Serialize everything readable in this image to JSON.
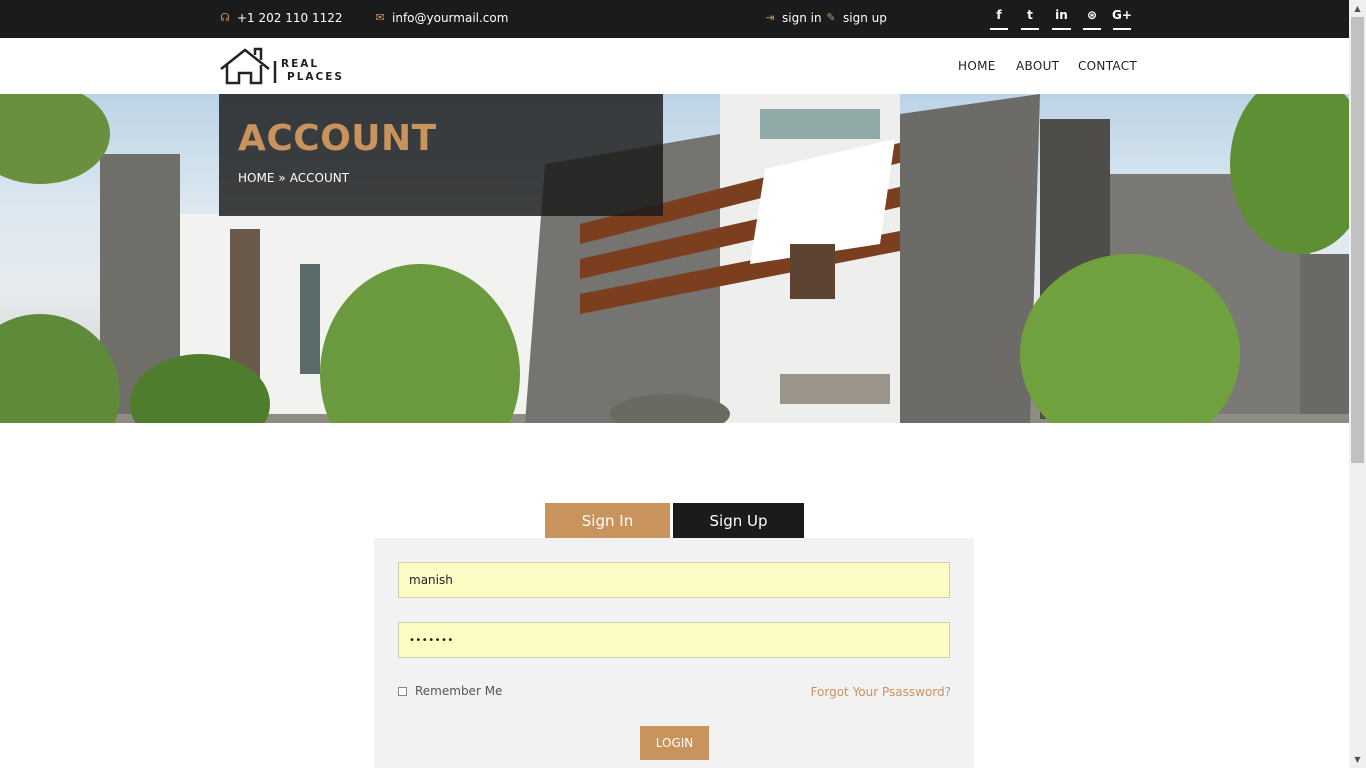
{
  "topbar": {
    "phone": "+1 202 110 1122",
    "email": "info@yourmail.com",
    "sign_in": "sign in",
    "sign_up": "sign up",
    "social": [
      {
        "glyph": "f",
        "icon": "facebook-icon"
      },
      {
        "glyph": "t",
        "icon": "twitter-icon"
      },
      {
        "glyph": "in",
        "icon": "linkedin-icon"
      },
      {
        "glyph": "⊛",
        "icon": "dribbble-icon"
      },
      {
        "glyph": "G+",
        "icon": "google-plus-icon"
      }
    ]
  },
  "header": {
    "logo_line1": "REAL",
    "logo_line2": "PLACES",
    "nav": [
      "HOME",
      "ABOUT",
      "CONTACT"
    ]
  },
  "hero": {
    "title": "ACCOUNT",
    "breadcrumb_home": "HOME",
    "breadcrumb_sep": "»",
    "breadcrumb_current": "ACCOUNT"
  },
  "tabs": {
    "sign_in": "Sign In",
    "sign_up": "Sign Up"
  },
  "form": {
    "username_value": "manish",
    "password_value": "•••••••",
    "remember_label": "Remember Me",
    "forgot_label": "Forgot Your Psassword?",
    "login_label": "LOGIN"
  },
  "colors": {
    "accent": "#c9935e",
    "dark": "#1b1b1b",
    "field_bg": "#fbfdc5",
    "panel_bg": "#f2f2f2"
  }
}
